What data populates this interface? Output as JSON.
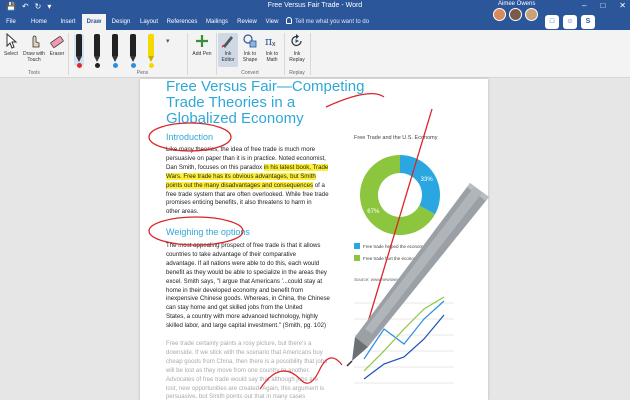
{
  "window": {
    "title": "Free Versus Fair Trade - Word",
    "account_name": "Aimee Owens"
  },
  "tabs": [
    {
      "label": "File"
    },
    {
      "label": "Home"
    },
    {
      "label": "Insert"
    },
    {
      "label": "Draw"
    },
    {
      "label": "Design"
    },
    {
      "label": "Layout"
    },
    {
      "label": "References"
    },
    {
      "label": "Mailings"
    },
    {
      "label": "Review"
    },
    {
      "label": "View"
    }
  ],
  "tell_me": "Tell me what you want to do",
  "ribbon": {
    "tools": {
      "select": "Select",
      "draw_with_touch": "Draw with Touch",
      "eraser": "Eraser",
      "group": "Tools"
    },
    "pens": {
      "add_pen": "Add Pen",
      "group": "Pens",
      "colors": [
        "#e8272a",
        "#222222",
        "#2a8fe0",
        "#2a8fe0",
        "#f5d800"
      ]
    },
    "convert": {
      "ink_editor": "Ink Editor",
      "ink_to_shape": "Ink to Shape",
      "ink_to_math": "Ink to Math",
      "group": "Convert"
    },
    "replay": {
      "ink_replay": "Ink Replay",
      "group": "Replay"
    }
  },
  "document": {
    "title": "Free Versus Fair—Competing Trade Theories in a Globalized Economy",
    "intro_heading": "Introduction",
    "intro_lines": [
      {
        "segments": [
          {
            "t": "Like many theories, the idea of free trade is much more",
            "h": false
          }
        ]
      },
      {
        "segments": [
          {
            "t": "persuasive on paper than it is in practice. Noted economist,",
            "h": false
          }
        ]
      },
      {
        "segments": [
          {
            "t": "Dan Smith, focuses on this paradox ",
            "h": false
          },
          {
            "t": "in his latest book, Trade",
            "h": true
          }
        ]
      },
      {
        "segments": [
          {
            "t": "Wars. Free trade has its obvious advantages, but Smith",
            "h": true
          }
        ]
      },
      {
        "segments": [
          {
            "t": "points out the many disadvantages and consequences",
            "h": true
          },
          {
            "t": " of a",
            "h": false
          }
        ]
      },
      {
        "segments": [
          {
            "t": "free trade system that are often overlooked. While free trade",
            "h": false
          }
        ]
      },
      {
        "segments": [
          {
            "t": "promises enticing benefits, it also threatens to harm in",
            "h": false
          }
        ]
      },
      {
        "segments": [
          {
            "t": "other areas.",
            "h": false
          }
        ]
      }
    ],
    "options_heading": "Weighing the options",
    "options_lines": [
      "The most appealing prospect of free trade is that it allows",
      "countries to take advantage of their comparative",
      "advantage. If all nations were able to do this, each would",
      "benefit as they would be able to specialize in the areas they",
      "excel. Smith says, \"I argue that Americans '...could stay at",
      "home in their developed economy and benefit from",
      "inexpensive Chinese goods. Whereas, in China, the Chinese",
      "can stay home and get skilled jobs from the United",
      "States, a country with more advanced technology, highly",
      "skilled labor, and large capital investment.\" (Smith, pg. 102)"
    ],
    "faded_lines": [
      "Free trade certainly paints a rosy picture, but there's a",
      "downside. If we stick with the scenario that Americans buy",
      "cheap goods from China, then there is a possibility that jobs",
      "will be lost as they move from one country to another.",
      "Advocates of free trade would say that although jobs are",
      "lost, new opportunities are created. Again, this argument is",
      "persuasive, but Smith points out that in many cases"
    ],
    "sidebar": {
      "chart_title": "Free Trade and the U.S. Economy",
      "legend_helped": "Free trade helped the economy",
      "legend_hurt": "Free trade hurt the economy",
      "source": "Source: www.newsweek.com"
    }
  },
  "chart_data": [
    {
      "type": "pie",
      "title": "Free Trade and the U.S. Economy",
      "categories": [
        "Free trade helped the economy",
        "Free trade hurt the economy"
      ],
      "values": [
        33,
        67
      ],
      "labels": [
        "33%",
        "67%"
      ],
      "colors": [
        "#2aa7e0",
        "#8cc63f"
      ]
    }
  ],
  "colors": {
    "word_blue": "#2b579a",
    "heading_blue": "#2fa8d8",
    "ink_red": "#d9252a",
    "highlight": "#fff13a"
  }
}
